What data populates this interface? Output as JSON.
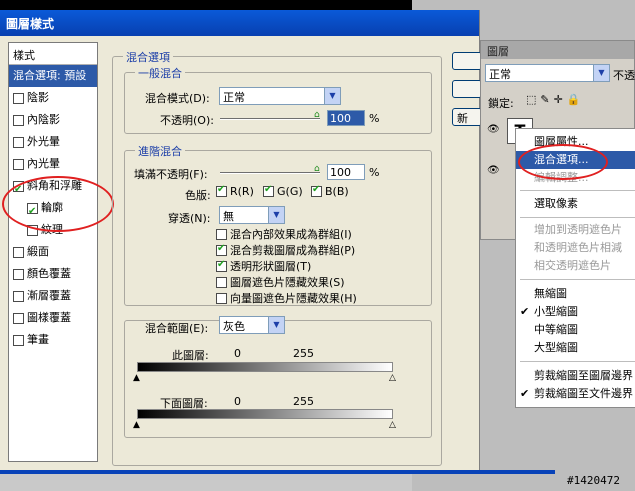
{
  "dialog": {
    "title": "圖層樣式",
    "styles_header": "樣式",
    "style_items": [
      {
        "label": "混合選項: 預設",
        "checkbox": false,
        "checked": false,
        "selected": true,
        "indent": false
      },
      {
        "label": "陰影",
        "checkbox": true,
        "checked": false,
        "selected": false,
        "indent": false
      },
      {
        "label": "內陰影",
        "checkbox": true,
        "checked": false,
        "selected": false,
        "indent": false
      },
      {
        "label": "外光暈",
        "checkbox": true,
        "checked": false,
        "selected": false,
        "indent": false
      },
      {
        "label": "內光暈",
        "checkbox": true,
        "checked": false,
        "selected": false,
        "indent": false
      },
      {
        "label": "斜角和浮雕",
        "checkbox": true,
        "checked": true,
        "selected": false,
        "indent": false
      },
      {
        "label": "輪廓",
        "checkbox": true,
        "checked": true,
        "selected": false,
        "indent": true
      },
      {
        "label": "紋理",
        "checkbox": true,
        "checked": false,
        "selected": false,
        "indent": true
      },
      {
        "label": "緞面",
        "checkbox": true,
        "checked": false,
        "selected": false,
        "indent": false
      },
      {
        "label": "顏色覆蓋",
        "checkbox": true,
        "checked": false,
        "selected": false,
        "indent": false
      },
      {
        "label": "漸層覆蓋",
        "checkbox": true,
        "checked": false,
        "selected": false,
        "indent": false
      },
      {
        "label": "圖樣覆蓋",
        "checkbox": true,
        "checked": false,
        "selected": false,
        "indent": false
      },
      {
        "label": "筆畫",
        "checkbox": true,
        "checked": false,
        "selected": false,
        "indent": false
      }
    ],
    "blending_options_title": "混合選項",
    "general_title": "一般混合",
    "blend_mode_label": "混合模式(D):",
    "blend_mode_value": "正常",
    "opacity_label": "不透明(O):",
    "opacity_value": "100",
    "percent": "%",
    "advanced_title": "進階混合",
    "fill_opacity_label": "填滿不透明(F):",
    "fill_opacity_value": "100",
    "channels_label": "色版:",
    "channel_r": "R(R)",
    "channel_g": "G(G)",
    "channel_b": "B(B)",
    "knockout_label": "穿透(N):",
    "knockout_value": "無",
    "adv_options": [
      {
        "label": "混合內部效果成為群組(I)",
        "checked": false
      },
      {
        "label": "混合剪裁圖層成為群組(P)",
        "checked": true
      },
      {
        "label": "透明形狀圖層(T)",
        "checked": true
      },
      {
        "label": "圖層遮色片隱藏效果(S)",
        "checked": false
      },
      {
        "label": "向量圖遮色片隱藏效果(H)",
        "checked": false
      }
    ],
    "blend_if_label": "混合範圍(E):",
    "blend_if_value": "灰色",
    "this_layer_label": "此圖層:",
    "underlying_label": "下面圖層:",
    "range_min": "0",
    "range_max": "255",
    "right_button_partial": "新"
  },
  "layers_panel": {
    "title": "圖層",
    "blend_mode": "正常",
    "opacity_partial": "不透",
    "lock_label": "鎖定:",
    "thumb_letter": "T"
  },
  "context_menu": {
    "items": [
      {
        "label": "圖層屬性...",
        "state": "normal",
        "check": false
      },
      {
        "label": "混合選項...",
        "state": "selected",
        "check": false
      },
      {
        "label": "編輯調整...",
        "state": "disabled",
        "check": false
      },
      {
        "label": "選取像素",
        "state": "normal",
        "check": false
      },
      {
        "label": "增加到透明遮色片",
        "state": "disabled",
        "check": false
      },
      {
        "label": "和透明遮色片相減",
        "state": "disabled",
        "check": false
      },
      {
        "label": "相交透明遮色片",
        "state": "disabled",
        "check": false
      },
      {
        "label": "無縮圖",
        "state": "normal",
        "check": false
      },
      {
        "label": "小型縮圖",
        "state": "normal",
        "check": true
      },
      {
        "label": "中等縮圖",
        "state": "normal",
        "check": false
      },
      {
        "label": "大型縮圖",
        "state": "normal",
        "check": false
      },
      {
        "label": "剪裁縮圖至圖層邊界",
        "state": "normal",
        "check": false
      },
      {
        "label": "剪裁縮圖至文件邊界",
        "state": "normal",
        "check": true
      }
    ]
  },
  "watermark": "#1420472",
  "colors": {
    "accent": "#e02020",
    "title_bar": "#0a5ad8",
    "selection": "#2d5aa8",
    "group_title": "#1d3fa8"
  }
}
